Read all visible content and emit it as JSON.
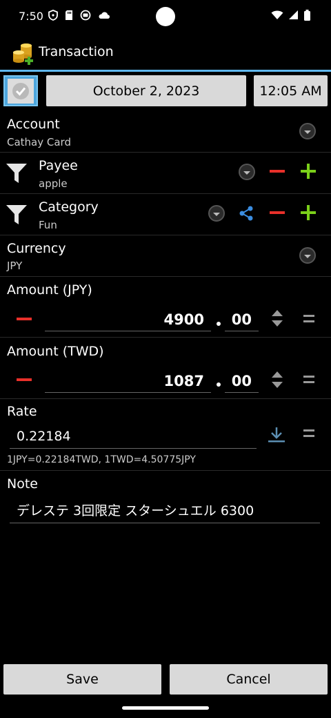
{
  "status": {
    "time": "7:50"
  },
  "header": {
    "title": "Transaction"
  },
  "datetime": {
    "date": "October 2, 2023",
    "time": "12:05 AM"
  },
  "account": {
    "label": "Account",
    "value": "Cathay Card"
  },
  "payee": {
    "label": "Payee",
    "value": "apple"
  },
  "category": {
    "label": "Category",
    "value": "Fun"
  },
  "currency": {
    "label": "Currency",
    "value": "JPY"
  },
  "amount_jpy": {
    "label": "Amount (JPY)",
    "integer": "4900",
    "decimal": "00"
  },
  "amount_twd": {
    "label": "Amount (TWD)",
    "integer": "1087",
    "decimal": "00"
  },
  "rate": {
    "label": "Rate",
    "value": "0.22184",
    "info": "1JPY=0.22184TWD, 1TWD=4.50775JPY"
  },
  "note": {
    "label": "Note",
    "value": "デレステ 3回限定 スターシュエル 6300"
  },
  "footer": {
    "save_label": "Save",
    "cancel_label": "Cancel"
  },
  "colors": {
    "accent": "#5fb7ee",
    "minus": "#e8302a",
    "plus": "#7bd01a",
    "share": "#3b8de0"
  }
}
